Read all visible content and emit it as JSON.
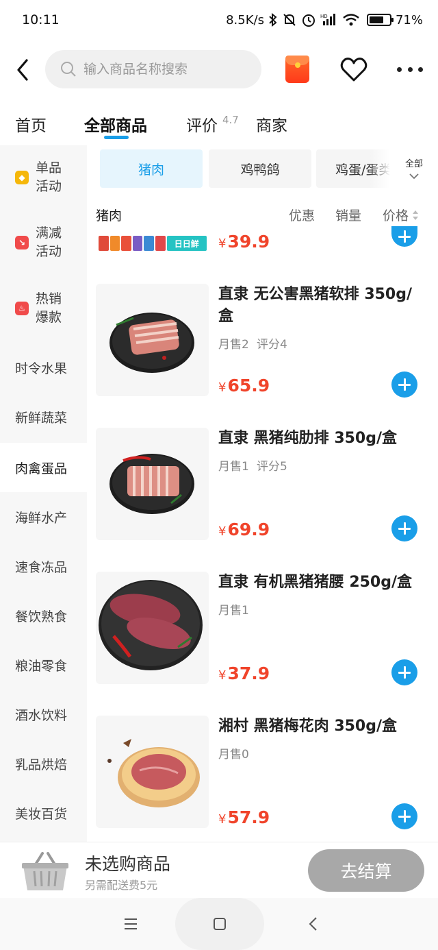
{
  "status_bar": {
    "time": "10:11",
    "network_speed": "8.5K/s",
    "battery": "71%",
    "battery_level": 0.71
  },
  "header": {
    "search_placeholder": "输入商品名称搜索",
    "icons": [
      "back-icon",
      "search-icon",
      "red-packet-icon",
      "heart-icon",
      "more-icon"
    ]
  },
  "tabs": [
    {
      "label": "首页"
    },
    {
      "label": "全部商品",
      "active": true
    },
    {
      "label": "评价",
      "badge": "4.7"
    },
    {
      "label": "商家"
    }
  ],
  "sidebar": [
    {
      "label": "单品\n活动",
      "tag_color": "#f5b70a",
      "icon": "tag-icon"
    },
    {
      "label": "满减\n活动",
      "tag_color": "#f04b4b",
      "icon": "discount-icon"
    },
    {
      "label": "热销\n爆款",
      "tag_color": "#f04b4b",
      "icon": "fire-icon"
    },
    {
      "label": "时令水果"
    },
    {
      "label": "新鲜蔬菜"
    },
    {
      "label": "肉禽蛋品",
      "active": true
    },
    {
      "label": "海鲜水产"
    },
    {
      "label": "速食冻品"
    },
    {
      "label": "餐饮熟食"
    },
    {
      "label": "粮油零食"
    },
    {
      "label": "酒水饮料"
    },
    {
      "label": "乳品烘焙"
    },
    {
      "label": "美妆百货"
    }
  ],
  "chips": [
    {
      "label": "猪肉",
      "active": true
    },
    {
      "label": "鸡鸭鸽"
    },
    {
      "label": "鸡蛋/蛋类"
    }
  ],
  "chip_all_label": "全部",
  "list_header": {
    "title": "猪肉",
    "sort_discount": "优惠",
    "sort_sales": "销量",
    "sort_price": "价格"
  },
  "partial_product": {
    "price": "39.9",
    "banner_text": "日日鲜"
  },
  "products": [
    {
      "name": "直隶 无公害黑猪软排 350g/盒",
      "sold": "月售2",
      "rating": "评分4",
      "price": "65.9"
    },
    {
      "name": "直隶 黑猪纯肋排 350g/盒",
      "sold": "月售1",
      "rating": "评分5",
      "price": "69.9"
    },
    {
      "name": "直隶 有机黑猪猪腰 250g/盒",
      "sold": "月售1",
      "rating": "",
      "price": "37.9"
    },
    {
      "name": "湘村 黑猪梅花肉 350g/盒",
      "sold": "月售0",
      "rating": "",
      "price": "57.9"
    }
  ],
  "currency_symbol": "¥",
  "cart": {
    "title": "未选购商品",
    "subtitle": "另需配送费5元",
    "checkout_label": "去结算"
  },
  "colors": {
    "accent": "#1a9ee8",
    "price": "#f0442b",
    "checkout_disabled": "#a8a8a8"
  }
}
